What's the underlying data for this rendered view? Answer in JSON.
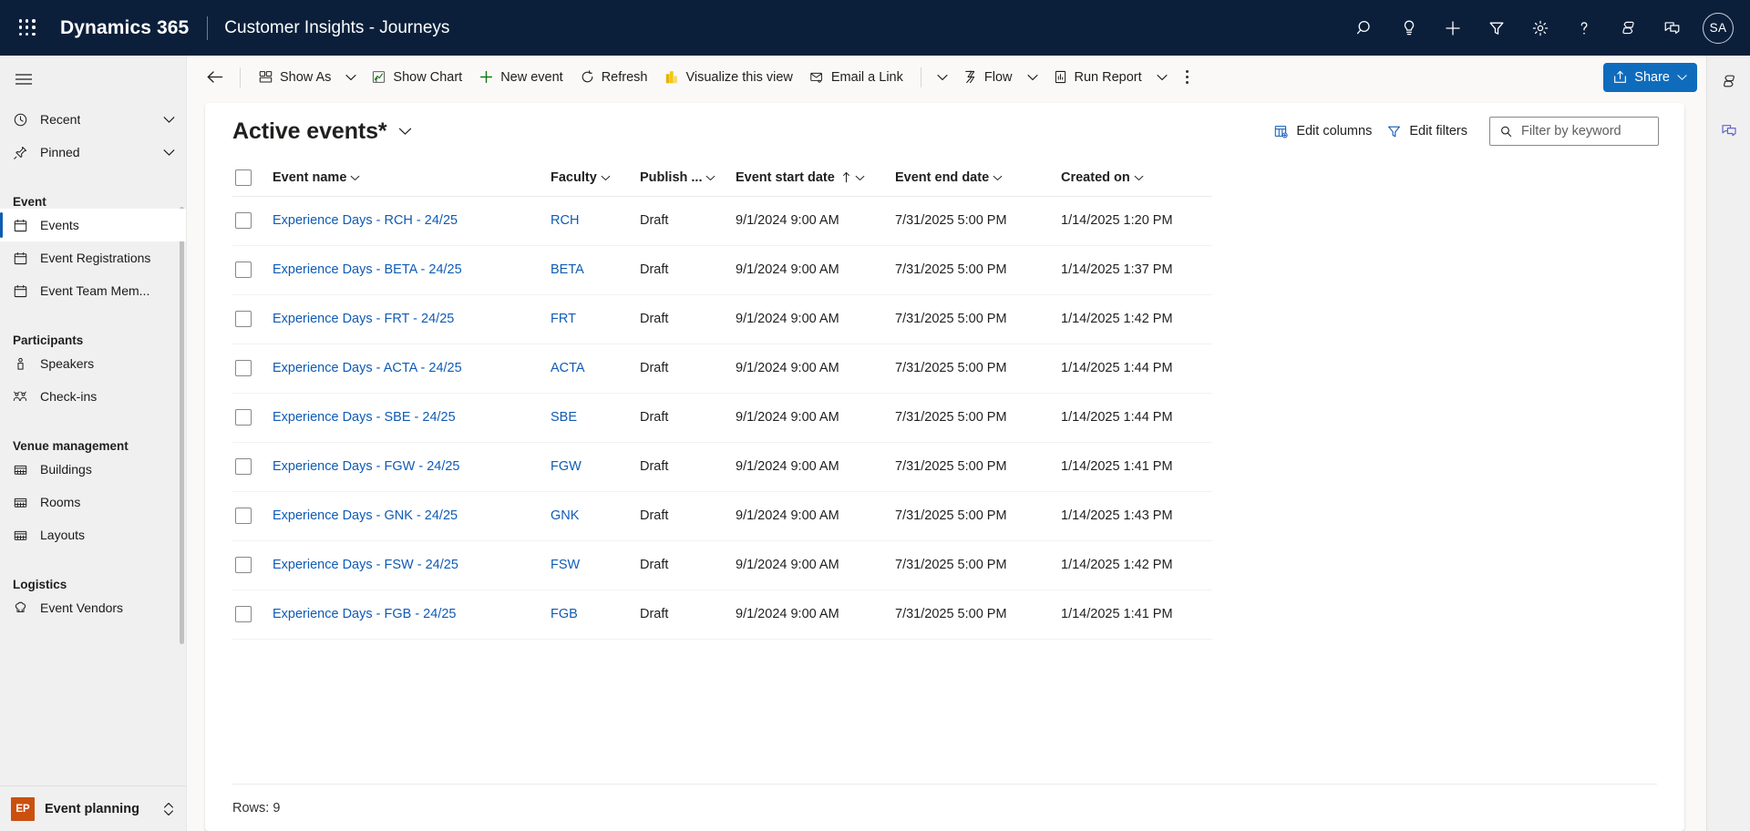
{
  "header": {
    "waffle_icon": "app-launcher-waffle-icon",
    "brand": "Dynamics 365",
    "app_name": "Customer Insights - Journeys",
    "icons": [
      {
        "name": "search-icon",
        "label": "Search"
      },
      {
        "name": "lightbulb-icon",
        "label": "Insights"
      },
      {
        "name": "plus-icon",
        "label": "Quick create"
      },
      {
        "name": "filter-icon",
        "label": "Filters"
      },
      {
        "name": "gear-icon",
        "label": "Settings"
      },
      {
        "name": "help-icon",
        "label": "Help"
      },
      {
        "name": "copilot-icon",
        "label": "Copilot"
      },
      {
        "name": "feedback-icon",
        "label": "Feedback"
      }
    ],
    "avatar_initials": "SA",
    "background_color": "#0b1f3b"
  },
  "sidebar": {
    "hamburger_label": "Expand/collapse navigation",
    "quick": [
      {
        "label": "Recent",
        "icon": "clock-icon"
      },
      {
        "label": "Pinned",
        "icon": "pin-icon"
      }
    ],
    "groups": [
      {
        "title": "Event",
        "items": [
          {
            "label": "Events",
            "icon": "calendar-icon",
            "selected": true
          },
          {
            "label": "Event Registrations",
            "icon": "calendar-icon",
            "selected": false
          },
          {
            "label": "Event Team Mem...",
            "icon": "calendar-icon",
            "selected": false
          }
        ]
      },
      {
        "title": "Participants",
        "items": [
          {
            "label": "Speakers",
            "icon": "speaker-person-icon",
            "selected": false
          },
          {
            "label": "Check-ins",
            "icon": "people-icon",
            "selected": false
          }
        ]
      },
      {
        "title": "Venue management",
        "items": [
          {
            "label": "Buildings",
            "icon": "building-icon",
            "selected": false
          },
          {
            "label": "Rooms",
            "icon": "building-icon",
            "selected": false
          },
          {
            "label": "Layouts",
            "icon": "building-icon",
            "selected": false
          }
        ]
      },
      {
        "title": "Logistics",
        "items": [
          {
            "label": "Event Vendors",
            "icon": "chef-hat-icon",
            "selected": false
          }
        ]
      }
    ],
    "area_switcher": {
      "badge": "EP",
      "badge_color": "#ca5010",
      "label": "Event planning",
      "icon": "up-down-chevron-icon"
    }
  },
  "command_bar": {
    "back_icon": "arrow-left-icon",
    "buttons": [
      {
        "label": "Show As",
        "icon": "show-as-icon",
        "caret": true
      },
      {
        "label": "Show Chart",
        "icon": "chart-icon",
        "caret": false
      },
      {
        "label": "New event",
        "icon": "plus-icon",
        "caret": false
      },
      {
        "label": "Refresh",
        "icon": "refresh-icon",
        "caret": false
      },
      {
        "label": "Visualize this view",
        "icon": "powerbi-icon",
        "caret": false
      },
      {
        "label": "Email a Link",
        "icon": "email-link-icon",
        "caret": true
      },
      {
        "label": "Flow",
        "icon": "flow-icon",
        "caret": true
      },
      {
        "label": "Run Report",
        "icon": "report-icon",
        "caret": true
      }
    ],
    "overflow_label": "More commands",
    "share": {
      "label": "Share",
      "icon": "share-icon",
      "caret": true,
      "color": "#0f6cbd"
    }
  },
  "view": {
    "title": "Active events*",
    "title_caret": "chevron-down-icon",
    "edit_columns": {
      "label": "Edit columns",
      "icon": "edit-columns-icon"
    },
    "edit_filters": {
      "label": "Edit filters",
      "icon": "filter-icon"
    },
    "search": {
      "placeholder": "Filter by keyword",
      "value": "",
      "icon": "search-icon"
    }
  },
  "table": {
    "select_all_label": "Select all rows",
    "columns": [
      {
        "key": "name",
        "label": "Event name",
        "sorted": false
      },
      {
        "key": "fac",
        "label": "Faculty",
        "sorted": false
      },
      {
        "key": "pub",
        "label": "Publish ...",
        "sorted": false
      },
      {
        "key": "start",
        "label": "Event start date",
        "sorted": true,
        "sort_dir": "asc"
      },
      {
        "key": "end",
        "label": "Event end date",
        "sorted": false
      },
      {
        "key": "cre",
        "label": "Created on",
        "sorted": false
      }
    ],
    "rows": [
      {
        "name": "Experience Days - RCH - 24/25",
        "fac": "RCH",
        "pub": "Draft",
        "start": "9/1/2024 9:00 AM",
        "end": "7/31/2025 5:00 PM",
        "cre": "1/14/2025 1:20 PM"
      },
      {
        "name": "Experience Days - BETA - 24/25",
        "fac": "BETA",
        "pub": "Draft",
        "start": "9/1/2024 9:00 AM",
        "end": "7/31/2025 5:00 PM",
        "cre": "1/14/2025 1:37 PM"
      },
      {
        "name": "Experience Days - FRT - 24/25",
        "fac": "FRT",
        "pub": "Draft",
        "start": "9/1/2024 9:00 AM",
        "end": "7/31/2025 5:00 PM",
        "cre": "1/14/2025 1:42 PM"
      },
      {
        "name": "Experience Days - ACTA - 24/25",
        "fac": "ACTA",
        "pub": "Draft",
        "start": "9/1/2024 9:00 AM",
        "end": "7/31/2025 5:00 PM",
        "cre": "1/14/2025 1:44 PM"
      },
      {
        "name": "Experience Days - SBE - 24/25",
        "fac": "SBE",
        "pub": "Draft",
        "start": "9/1/2024 9:00 AM",
        "end": "7/31/2025 5:00 PM",
        "cre": "1/14/2025 1:44 PM"
      },
      {
        "name": "Experience Days - FGW - 24/25",
        "fac": "FGW",
        "pub": "Draft",
        "start": "9/1/2024 9:00 AM",
        "end": "7/31/2025 5:00 PM",
        "cre": "1/14/2025 1:41 PM"
      },
      {
        "name": "Experience Days - GNK - 24/25",
        "fac": "GNK",
        "pub": "Draft",
        "start": "9/1/2024 9:00 AM",
        "end": "7/31/2025 5:00 PM",
        "cre": "1/14/2025 1:43 PM"
      },
      {
        "name": "Experience Days - FSW - 24/25",
        "fac": "FSW",
        "pub": "Draft",
        "start": "9/1/2024 9:00 AM",
        "end": "7/31/2025 5:00 PM",
        "cre": "1/14/2025 1:42 PM"
      },
      {
        "name": "Experience Days - FGB - 24/25",
        "fac": "FGB",
        "pub": "Draft",
        "start": "9/1/2024 9:00 AM",
        "end": "7/31/2025 5:00 PM",
        "cre": "1/14/2025 1:41 PM"
      }
    ],
    "row_count_label": "Rows: 9"
  },
  "right_rail": {
    "items": [
      {
        "name": "copilot-icon",
        "label": "Copilot"
      },
      {
        "name": "feedback-icon",
        "label": "Feedback",
        "color": "#6264c7"
      }
    ]
  },
  "colors": {
    "accent": "#0f6cbd",
    "link": "#0f5bb5",
    "header_bg": "#0b1f3b",
    "sidebar_bg": "#f0f0f0",
    "page_bg": "#faf9f8"
  }
}
